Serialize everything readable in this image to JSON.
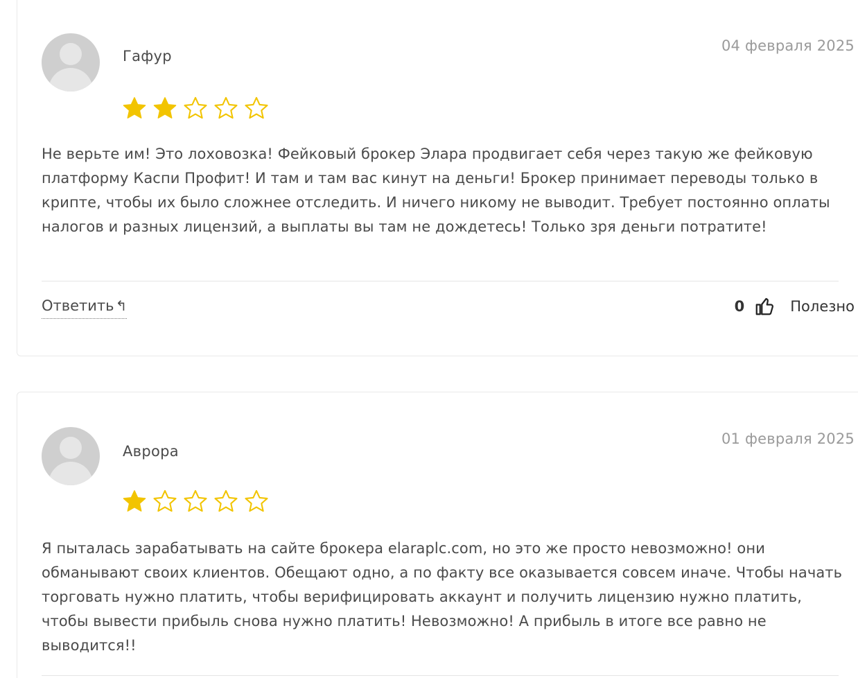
{
  "colors": {
    "star_filled": "#F2C400",
    "star_outline": "#F2C400",
    "text": "#4a4a4a",
    "date": "#9a9a9a"
  },
  "reviews": [
    {
      "author": "Гафур",
      "date": "04 февраля 2025",
      "rating": 2,
      "rating_max": 5,
      "text": "Не верьте им! Это лоховозка! Фейковый брокер Элара продвигает себя через такую же фейковую платформу Каспи Профит! И там и там вас кинут на деньги! Брокер принимает переводы только в крипте, чтобы их было сложнее отследить. И ничего никому не выводит. Требует постоянно оплаты налогов и разных лицензий, а выплаты вы там не дождетесь! Только зря деньги потратите!",
      "reply_label": "Ответить",
      "reply_icon": "↰",
      "helpful_count": "0",
      "helpful_label": "Полезно"
    },
    {
      "author": "Аврора",
      "date": "01 февраля 2025",
      "rating": 1,
      "rating_max": 5,
      "text": "Я пыталась зарабатывать на сайте брокера elaraplc.com, но это же просто невозможно! они обманывают своих клиентов. Обещают одно, а по факту все оказывается совсем иначе. Чтобы начать торговать нужно платить, чтобы верифицировать аккаунт и получить лицензию нужно платить, чтобы вывести прибыль снова нужно платить! Невозможно! А прибыль в итоге все равно не выводится!!"
    }
  ]
}
